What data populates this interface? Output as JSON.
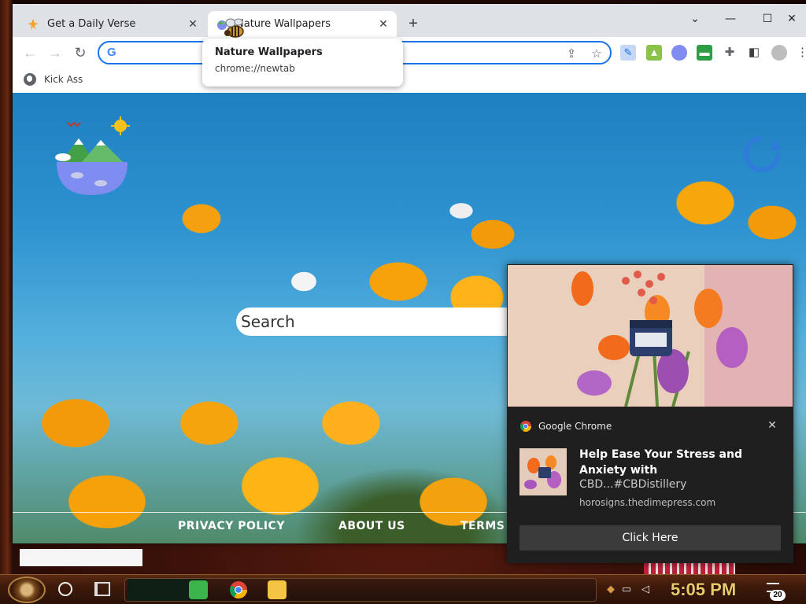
{
  "browser": {
    "tabs": [
      {
        "title": "Get a Daily Verse",
        "close": "✕"
      },
      {
        "title": "Nature Wallpapers",
        "close": "✕"
      }
    ],
    "new_tab": "+",
    "window_controls": {
      "menu": "⌄",
      "minimize": "—",
      "maximize": "☐",
      "close": "✕"
    },
    "nav": {
      "back": "←",
      "forward": "→",
      "reload": "↻"
    },
    "omnibox": {
      "value": "",
      "google_letter": "G"
    },
    "bookmarks": [
      {
        "label": "Kick Ass"
      }
    ],
    "tab_tooltip": {
      "title": "Nature Wallpapers",
      "url": "chrome://newtab"
    }
  },
  "page": {
    "search_placeholder": "Search",
    "footer_links": [
      "PRIVACY POLICY",
      "ABOUT US",
      "TERMS O"
    ]
  },
  "notification": {
    "app_name": "Google Chrome",
    "close": "✕",
    "title": "Help Ease Your Stress and Anxiety with",
    "body": "CBD...#CBDistillery",
    "site": "horosigns.thedimepress.com",
    "button_label": "Click Here"
  },
  "taskbar": {
    "time": "5:05 PM",
    "notification_count": "20"
  },
  "colors": {
    "accent": "#1a73e8",
    "time_color": "#e9c96a"
  }
}
